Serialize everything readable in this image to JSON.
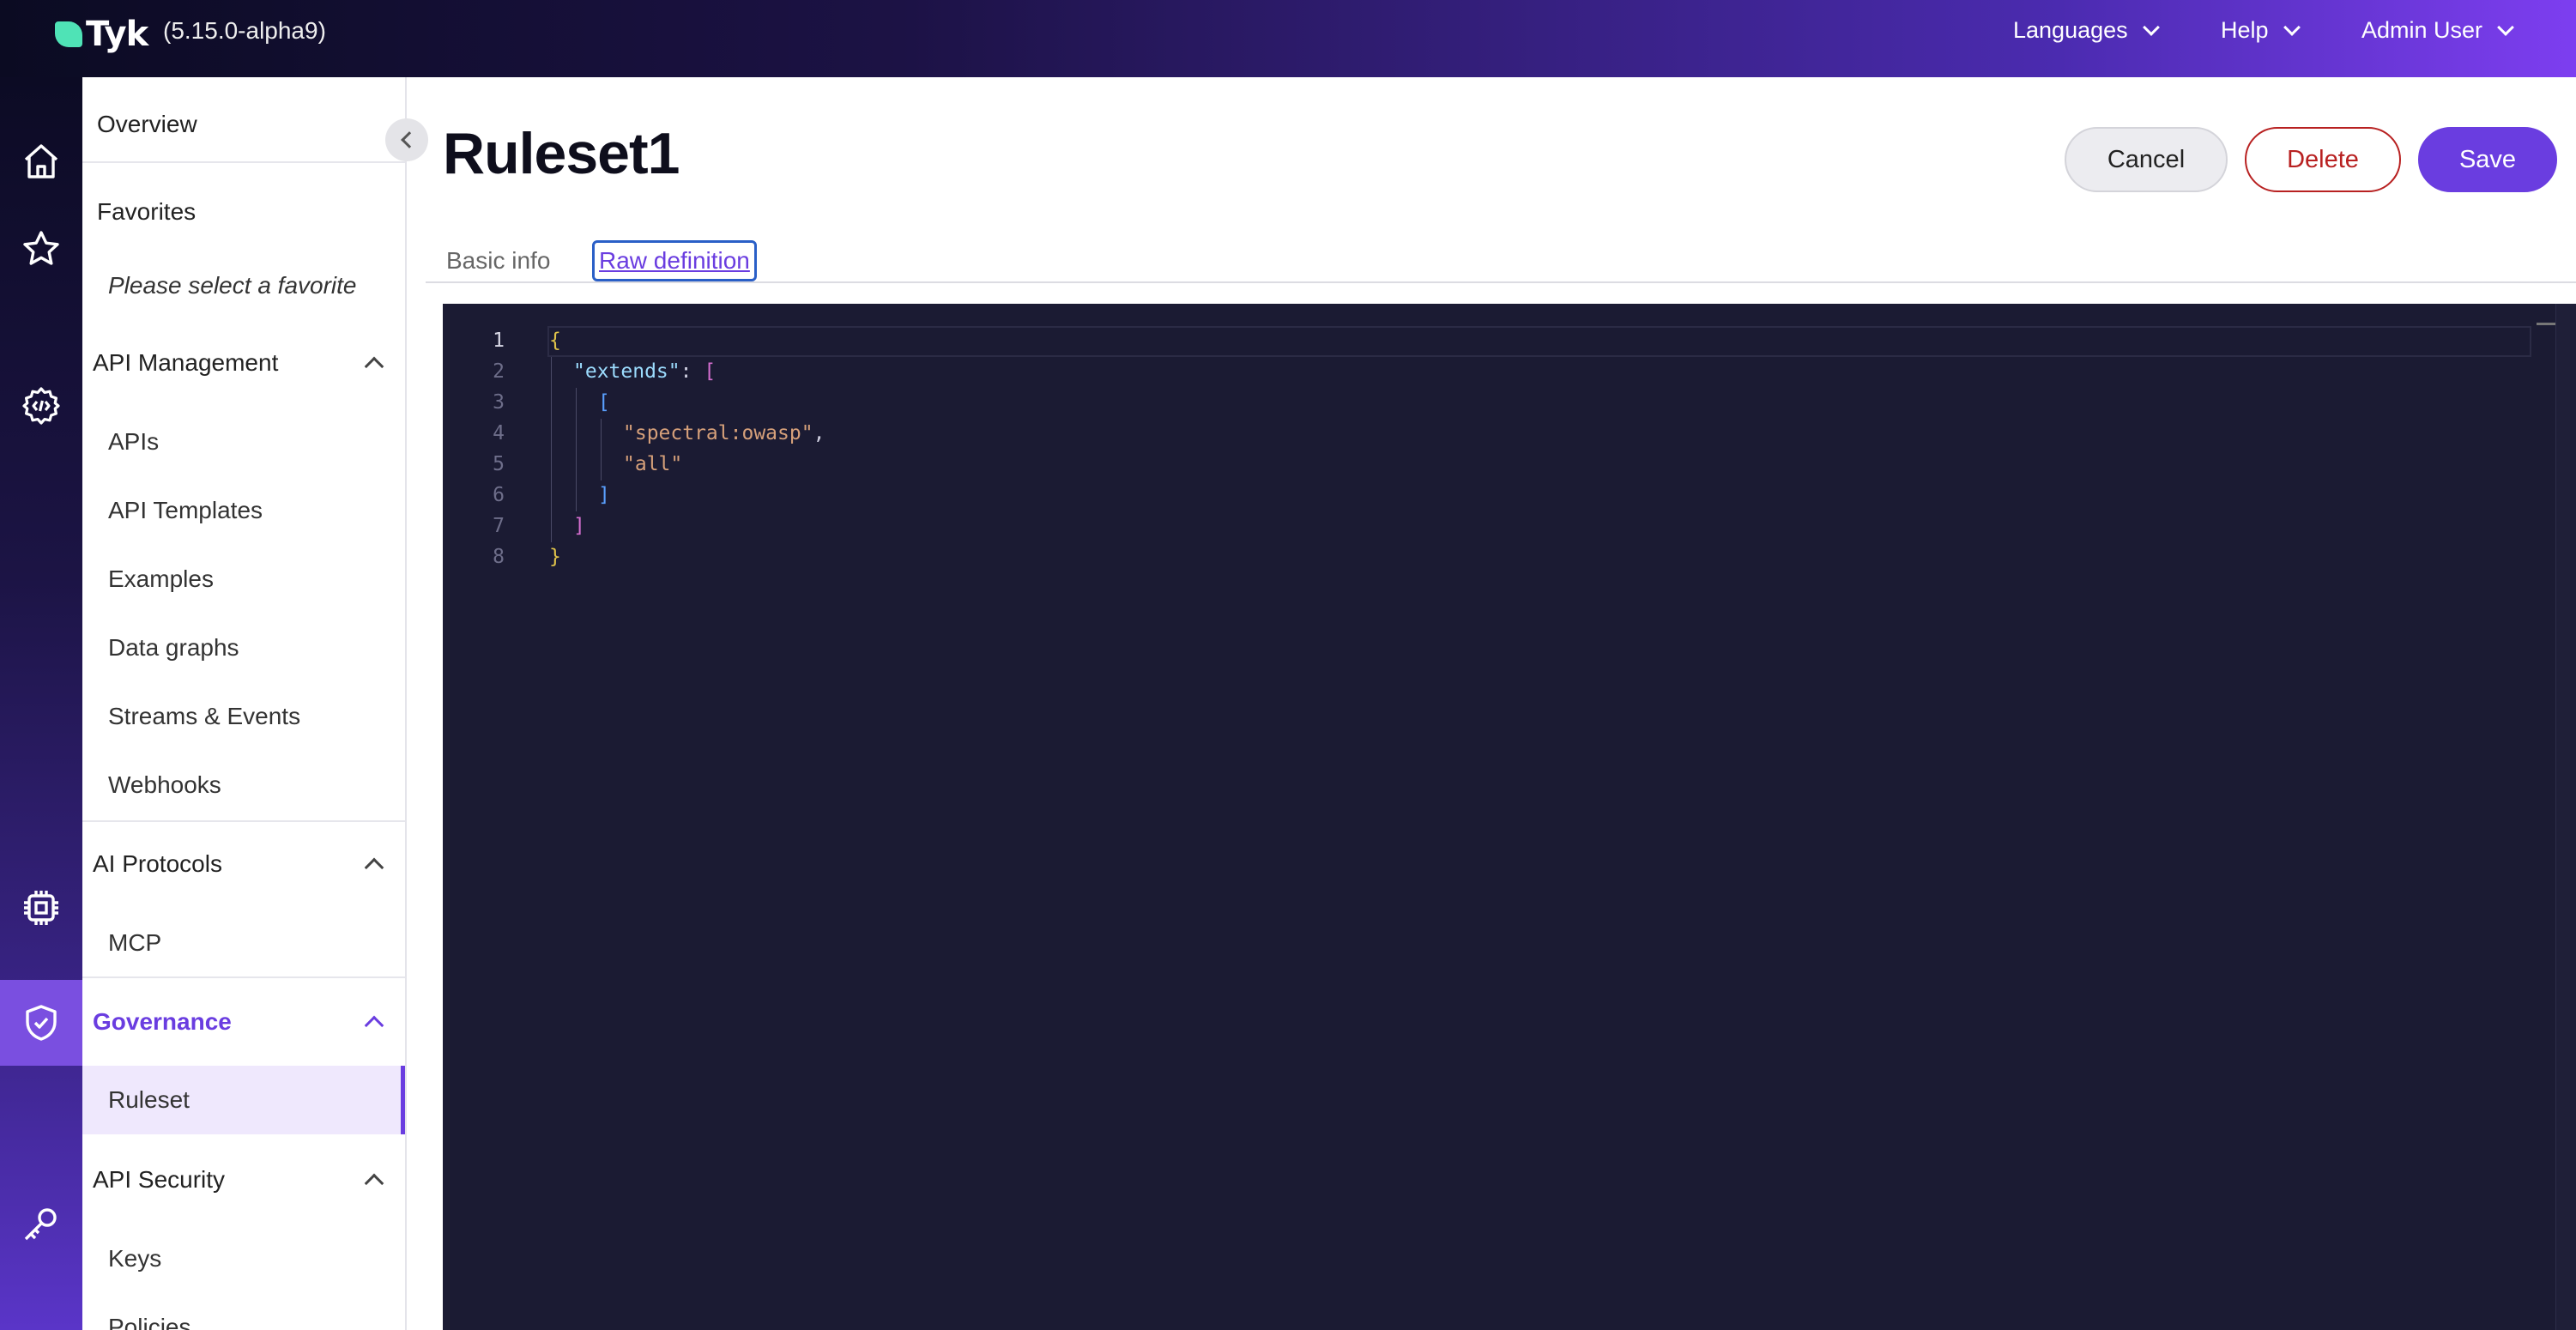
{
  "app": {
    "logo_text": "Tyk",
    "version": "(5.15.0-alpha9)"
  },
  "topnav": {
    "languages": "Languages",
    "help": "Help",
    "user": "Admin User"
  },
  "rail_icons": [
    "home-icon",
    "star-icon",
    "code-gear-icon",
    "chip-icon",
    "shield-check-icon",
    "key-icon"
  ],
  "sidebar": {
    "overview": "Overview",
    "favorites": "Favorites",
    "favorites_placeholder": "Please select a favorite",
    "api_management": {
      "label": "API Management",
      "items": [
        "APIs",
        "API Templates",
        "Examples",
        "Data graphs",
        "Streams & Events",
        "Webhooks"
      ]
    },
    "ai_protocols": {
      "label": "AI Protocols",
      "items": [
        "MCP"
      ]
    },
    "governance": {
      "label": "Governance",
      "items": [
        "Ruleset"
      ],
      "active_item": "Ruleset"
    },
    "api_security": {
      "label": "API Security",
      "items": [
        "Keys",
        "Policies"
      ]
    }
  },
  "page": {
    "title": "Ruleset1",
    "buttons": {
      "cancel": "Cancel",
      "delete": "Delete",
      "save": "Save"
    },
    "tabs": [
      "Basic info",
      "Raw definition"
    ],
    "active_tab": "Raw definition"
  },
  "editor": {
    "line_numbers": [
      "1",
      "2",
      "3",
      "4",
      "5",
      "6",
      "7",
      "8"
    ],
    "current_line": 1,
    "tokens": {
      "open_brace": "{",
      "key_extends": "\"extends\"",
      "colon": ": ",
      "open_outer": "[",
      "open_inner": "[",
      "str_spectral": "\"spectral:owasp\"",
      "comma": ",",
      "str_all": "\"all\"",
      "close_inner": "]",
      "close_outer": "]",
      "close_brace": "}"
    }
  },
  "colors": {
    "accent": "#6a3de0",
    "delete": "#b82121",
    "editor_bg": "#1b1b33"
  }
}
